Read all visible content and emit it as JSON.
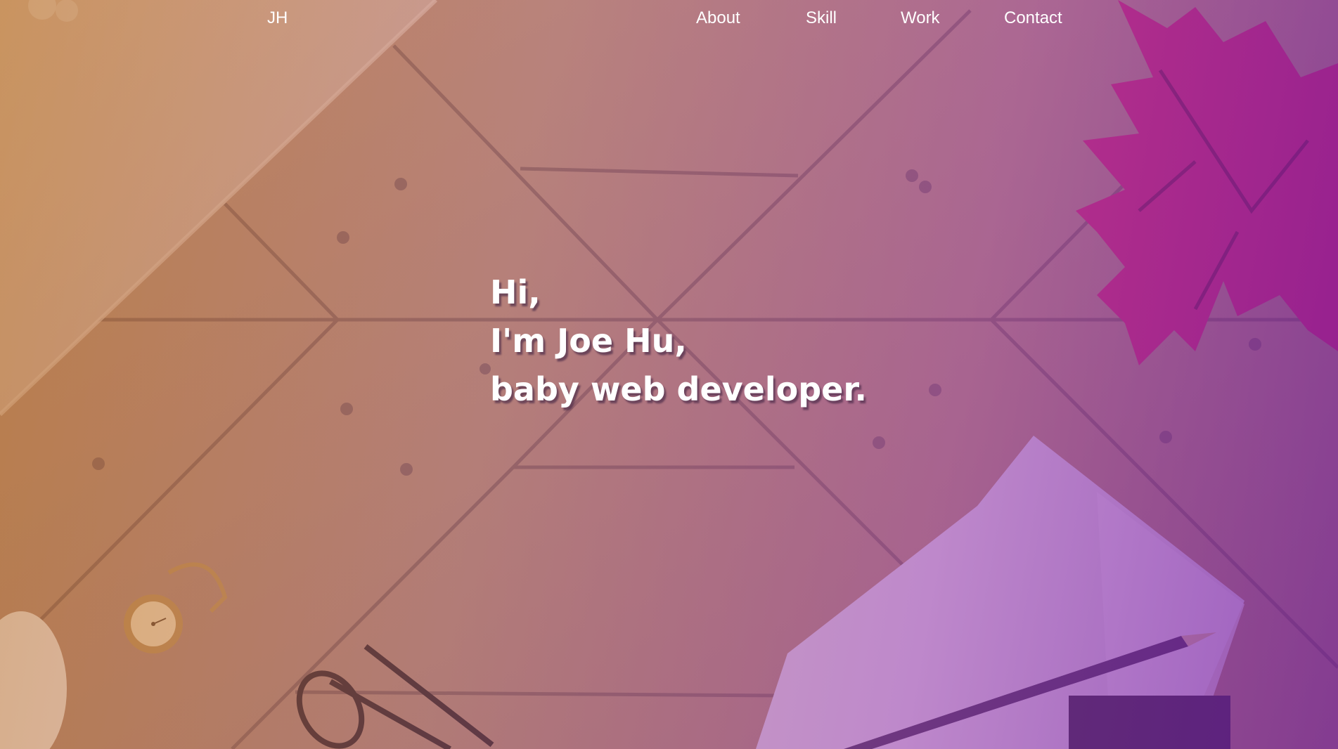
{
  "nav": {
    "logo": "JH",
    "links": [
      {
        "label": "About"
      },
      {
        "label": "Skill"
      },
      {
        "label": "Work"
      },
      {
        "label": "Contact"
      }
    ]
  },
  "hero": {
    "line1": "Hi,",
    "line2": "I'm Joe Hu,",
    "line3": "baby web developer."
  },
  "background": {
    "description_icons": [
      "laptop-corner",
      "maple-leaves",
      "paper-notes",
      "pencil",
      "pocket-watch",
      "eyeglasses",
      "wood-planks"
    ],
    "colors": {
      "overlay_left": "#be7628",
      "overlay_right": "#761eaa",
      "wood": "#a57a68"
    }
  }
}
